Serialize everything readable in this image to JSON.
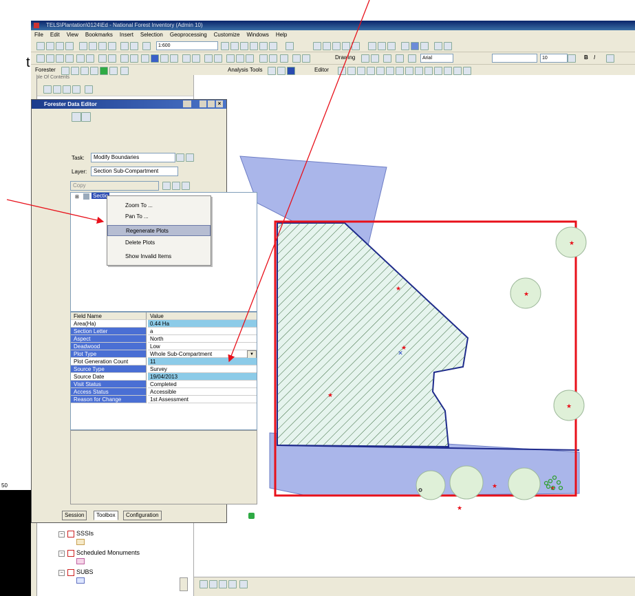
{
  "window": {
    "title": "TELS\\Plantation\\0124\\Ed - National Forest Inventory (Admin 10)"
  },
  "menu": [
    "File",
    "Edit",
    "View",
    "Bookmarks",
    "Insert",
    "Selection",
    "Geoprocessing",
    "Customize",
    "Windows",
    "Help"
  ],
  "toolbar": {
    "scale": "1:600",
    "drawing_label": "Drawing",
    "font": "Arial",
    "font_size": "10",
    "bold": "B",
    "italic": "I",
    "forester_label": "Forester",
    "analysis_tools_label": "Analysis Tools",
    "editor_label": "Editor"
  },
  "toc": {
    "header": "Table Of Contents",
    "layers": [
      {
        "label": "SSSIs",
        "swatch": "#f5e9c8",
        "swatch_border": "#c8a050"
      },
      {
        "label": "Scheduled Monuments",
        "swatch": "#f5d5e8",
        "swatch_border": "#c060a0"
      },
      {
        "label": "SUBS",
        "swatch": "#dde6ff",
        "swatch_border": "#6070c0"
      }
    ],
    "side_number": "50"
  },
  "editor": {
    "title": "Forester Data Editor",
    "task_label": "Task:",
    "task_value": "Modify Boundaries",
    "layer_label": "Layer:",
    "layer_value": "Section Sub-Compartment",
    "copy_label": "Copy",
    "tree_item": "Sectio",
    "context_menu": [
      "Zoom To ...",
      "Pan To ...",
      "Regenerate Plots",
      "Delete Plots",
      "Show Invalid Items"
    ],
    "grid_header": {
      "field": "Field Name",
      "value": "Value"
    },
    "grid_rows": [
      {
        "field": "Area(Ha)",
        "value": "0.44 Ha",
        "hl": false
      },
      {
        "field": "Section Letter",
        "value": "a",
        "hl": true
      },
      {
        "field": "Aspect",
        "value": "North",
        "hl": true
      },
      {
        "field": "Deadwood",
        "value": "Low",
        "hl": true
      },
      {
        "field": "Plot Type",
        "value": "Whole Sub-Compartment",
        "hl": true
      },
      {
        "field": "Plot Generation Count",
        "value": "11",
        "hl": false
      },
      {
        "field": "Source Type",
        "value": "Survey",
        "hl": true
      },
      {
        "field": "Source Date",
        "value": "19/04/2013",
        "hl": false
      },
      {
        "field": "Visit Status",
        "value": "Completed",
        "hl": true
      },
      {
        "field": "Access Status",
        "value": "Accessible",
        "hl": true
      },
      {
        "field": "Reason for Change",
        "value": "1st Assessment",
        "hl": true
      }
    ],
    "tabs": [
      "Session",
      "Toolbox",
      "Configuration"
    ]
  },
  "annotation": {
    "partial_text": "t"
  },
  "colors": {
    "field_highlight": "#4a6fd4",
    "value_highlight": "#8ccbe8",
    "selection_red": "#e8101a",
    "polygon_fill": "#aab6ea",
    "plot_circle": "#dff0d8"
  }
}
